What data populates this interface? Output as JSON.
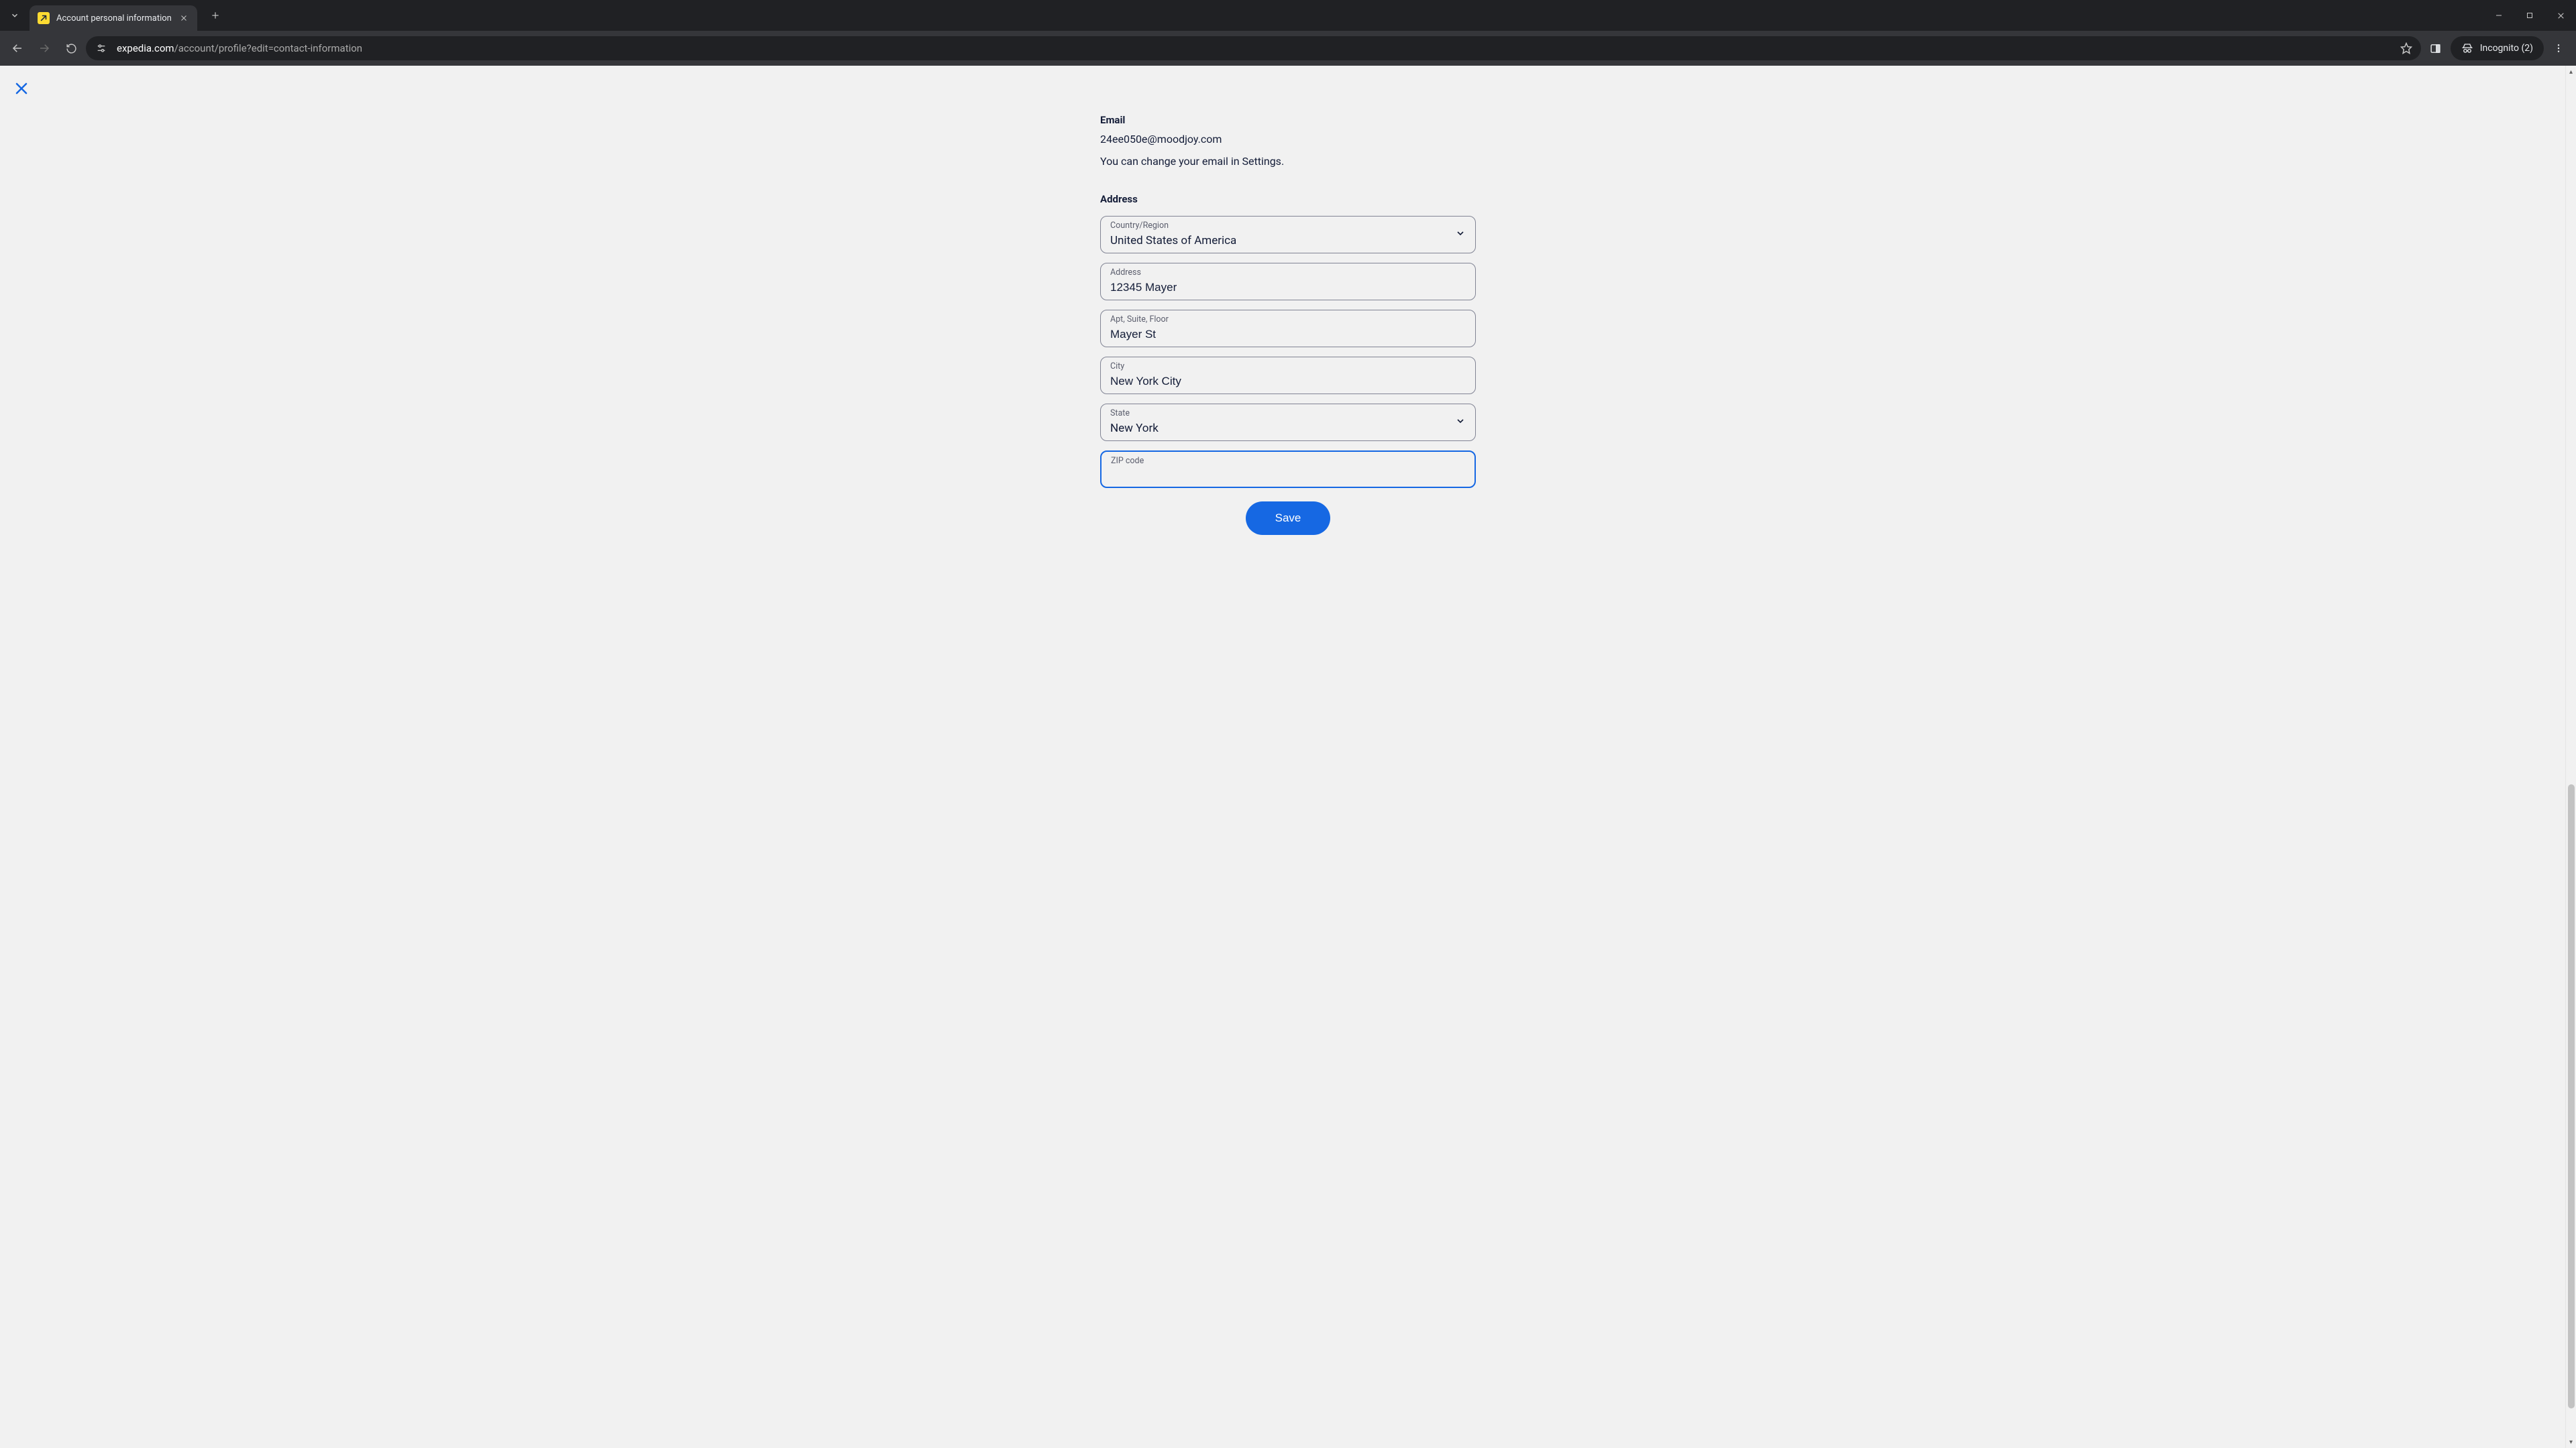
{
  "browser": {
    "tab_title": "Account personal information",
    "url_domain": "expedia.com",
    "url_path": "/account/profile?edit=contact-information",
    "incognito_label": "Incognito (2)"
  },
  "page": {
    "email_section_label": "Email",
    "email_value": "24ee050e@moodjoy.com",
    "email_note": "You can change your email in Settings.",
    "address_section_label": "Address",
    "fields": {
      "country": {
        "label": "Country/Region",
        "value": "United States of America"
      },
      "address": {
        "label": "Address",
        "value": "12345 Mayer"
      },
      "apt": {
        "label": "Apt, Suite, Floor",
        "value": "Mayer St"
      },
      "city": {
        "label": "City",
        "value": "New York City"
      },
      "state": {
        "label": "State",
        "value": "New York"
      },
      "zip": {
        "label": "ZIP code",
        "value": ""
      }
    },
    "save_label": "Save"
  }
}
